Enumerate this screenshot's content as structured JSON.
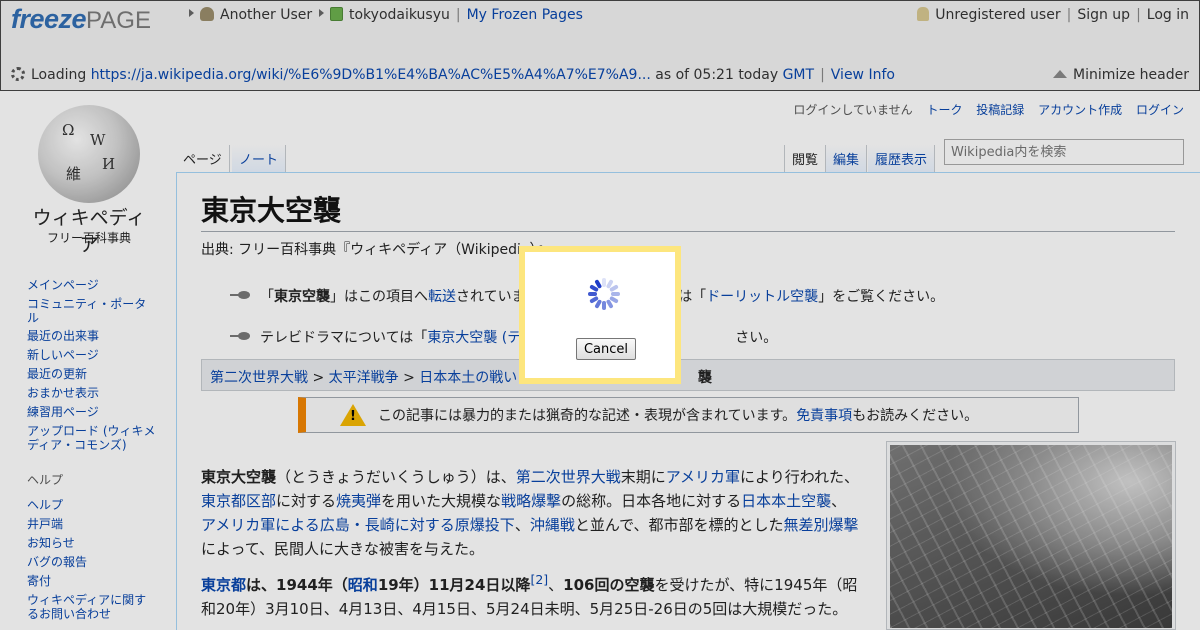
{
  "freezepage": {
    "logo_freeze": "freeze",
    "logo_page": "PAGE",
    "user_label": "Another User",
    "page_owner": "tokyodaikusyu",
    "my_frozen_pages": "My Frozen Pages",
    "unregistered": "Unregistered user",
    "sign_up": "Sign up",
    "log_in": "Log in",
    "loading": "Loading",
    "url": "https://ja.wikipedia.org/wiki/%E6%9D%B1%E4%BA%AC%E5%A4%A7%E7%A9...",
    "as_of": "as of 05:21 today",
    "tz": "GMT",
    "view_info": "View Info",
    "minimize": "Minimize header"
  },
  "wiki": {
    "logo_title": "ウィキペディア",
    "logo_sub": "フリー百科事典",
    "sidebar": [
      "メインページ",
      "コミュニティ・ポータル",
      "最近の出来事",
      "新しいページ",
      "最近の更新",
      "おまかせ表示",
      "練習用ページ",
      "アップロード (ウィキメディア・コモンズ)"
    ],
    "help_heading": "ヘルプ",
    "help_links": [
      "ヘルプ",
      "井戸端",
      "お知らせ",
      "バグの報告",
      "寄付",
      "ウィキペディアに関するお問い合わせ"
    ],
    "personal": [
      "ログインしていません",
      "トーク",
      "投稿記録",
      "アカウント作成",
      "ログイン"
    ],
    "tabs": {
      "page": "ページ",
      "note": "ノート",
      "read": "閲覧",
      "edit": "編集",
      "history": "履歴表示"
    },
    "search_placeholder": "Wikipedia内を検索",
    "title": "東京大空襲",
    "from": "出典: フリー百科事典『ウィキペディア（Wikipedia）』",
    "hat1": {
      "a": "「",
      "b": "東京空襲",
      "c": "」はこの項目へ",
      "d": "転送",
      "e": "されています。",
      "f": "は「",
      "g": "ドーリットル空襲",
      "h": "」をご覧ください。"
    },
    "hat2": {
      "a": "テレビドラマについては「",
      "b": "東京大空襲 (テ",
      "c": "さい。"
    },
    "breadcrumb": {
      "a": "第二次世界大戦",
      "b": "太平洋戦争",
      "c": "日本本土の戦い",
      "d": "襲",
      "sep": " > "
    },
    "warning": {
      "a": "この記事には暴力的または猟奇的な記述・表現が含まれています。",
      "b": "免責事項",
      "c": "もお読みください。"
    },
    "para1": [
      {
        "t": "東京大空襲",
        "k": "b"
      },
      {
        "t": "（とうきょうだいくうしゅう）は、",
        "k": ""
      },
      {
        "t": "第二次世界大戦",
        "k": "a"
      },
      {
        "t": "末期に",
        "k": ""
      },
      {
        "t": "アメリカ軍",
        "k": "a"
      },
      {
        "t": "により行われた、",
        "k": ""
      },
      {
        "t": "東京都区部",
        "k": "a"
      },
      {
        "t": "に対する",
        "k": ""
      },
      {
        "t": "焼夷弾",
        "k": "a"
      },
      {
        "t": "を用いた大規模な",
        "k": ""
      },
      {
        "t": "戦略爆撃",
        "k": "a"
      },
      {
        "t": "の総称。日本各地に対する",
        "k": ""
      },
      {
        "t": "日本本土空襲",
        "k": "a"
      },
      {
        "t": "、",
        "k": ""
      },
      {
        "t": "アメリカ軍による広島・長崎に対する原爆投下",
        "k": "a"
      },
      {
        "t": "、",
        "k": ""
      },
      {
        "t": "沖縄戦",
        "k": "a"
      },
      {
        "t": "と並んで、都市部を標的とした",
        "k": ""
      },
      {
        "t": "無差別爆撃",
        "k": "a"
      },
      {
        "t": "によって、民間人に大きな被害を与えた。",
        "k": ""
      }
    ],
    "para2": [
      {
        "t": "東京都",
        "k": "ab"
      },
      {
        "t": "は、",
        "k": "b"
      },
      {
        "t": "1944年",
        "k": "b"
      },
      {
        "t": "（",
        "k": "b"
      },
      {
        "t": "昭和",
        "k": "ab"
      },
      {
        "t": "19年）11月24日以降",
        "k": "b"
      },
      {
        "t": "[2]",
        "k": "sup"
      },
      {
        "t": "、",
        "k": ""
      },
      {
        "t": "106回の空襲",
        "k": "b"
      },
      {
        "t": "を受けたが、特に1945年（昭和20年）3月10日、4月13日、4月15日、5月24日未明、5月25日-26日の5回は大規模だった。",
        "k": ""
      }
    ]
  },
  "dialog": {
    "cancel": "Cancel"
  },
  "colors": {
    "dialog_border": "#fde67e",
    "freeze_blue": "#2f6db3",
    "link": "#0645ad",
    "spinner": "#1e3cc8"
  }
}
